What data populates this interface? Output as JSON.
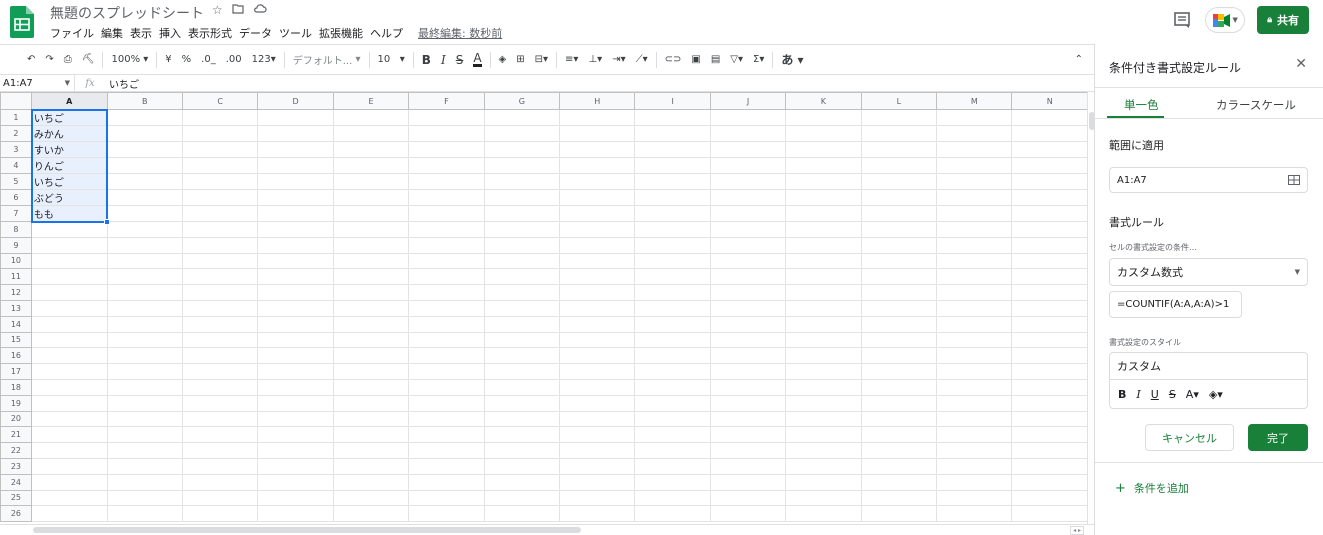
{
  "header": {
    "doc_title": "無題のスプレッドシート",
    "menu": [
      "ファイル",
      "編集",
      "表示",
      "挿入",
      "表示形式",
      "データ",
      "ツール",
      "拡張機能",
      "ヘルプ"
    ],
    "last_edit": "最終編集: 数秒前",
    "share_label": "共有"
  },
  "toolbar": {
    "zoom": "100%",
    "currency": "¥",
    "percent": "%",
    "decimal_decrease": ".0_",
    "decimal_increase": ".00",
    "number_format": "123",
    "font_family": "デフォルト...",
    "font_size": "10",
    "input_tool": "あ"
  },
  "formula_bar": {
    "name_box": "A1:A7",
    "fx": "fx",
    "value": "いちご"
  },
  "sheet": {
    "columns": [
      "A",
      "B",
      "C",
      "D",
      "E",
      "F",
      "G",
      "H",
      "I",
      "J",
      "K",
      "L",
      "M",
      "N"
    ],
    "row_count": 26,
    "cells_a": [
      "いちご",
      "みかん",
      "すいか",
      "りんご",
      "いちご",
      "ぶどう",
      "もも"
    ]
  },
  "panel": {
    "title": "条件付き書式設定ルール",
    "tab_single": "単一色",
    "tab_scale": "カラースケール",
    "range_label": "範囲に適用",
    "range_value": "A1:A7",
    "rules_label": "書式ルール",
    "condition_label": "セルの書式設定の条件…",
    "condition_value": "カスタム数式",
    "formula_value": "=COUNTIF(A:A,A:A)>1",
    "style_label": "書式設定のスタイル",
    "style_value": "カスタム",
    "cancel_label": "キャンセル",
    "done_label": "完了",
    "add_condition": "条件を追加"
  },
  "colors": {
    "accent": "#188038",
    "selection": "#1a73e8",
    "selection_fill": "#e8f0fe"
  }
}
